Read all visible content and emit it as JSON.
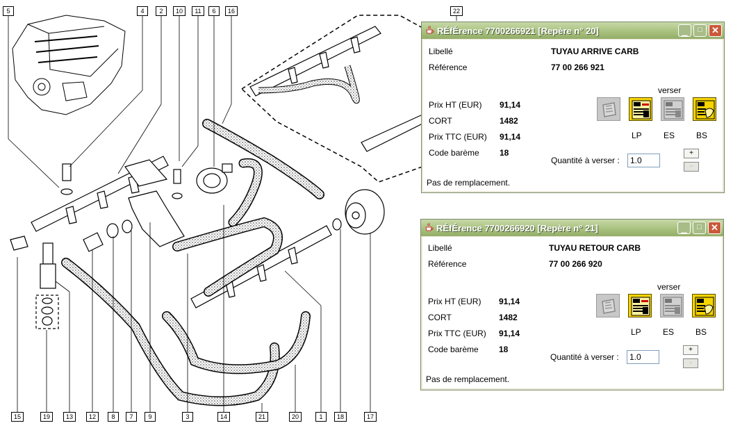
{
  "callouts": [
    {
      "id": "c5",
      "label": "5"
    },
    {
      "id": "c4",
      "label": "4"
    },
    {
      "id": "c2",
      "label": "2"
    },
    {
      "id": "c10",
      "label": "10"
    },
    {
      "id": "c11",
      "label": "11"
    },
    {
      "id": "c6",
      "label": "6"
    },
    {
      "id": "c16",
      "label": "16"
    },
    {
      "id": "c22",
      "label": "22"
    },
    {
      "id": "c15",
      "label": "15"
    },
    {
      "id": "c19",
      "label": "19"
    },
    {
      "id": "c13",
      "label": "13"
    },
    {
      "id": "c12",
      "label": "12"
    },
    {
      "id": "c8",
      "label": "8"
    },
    {
      "id": "c7",
      "label": "7"
    },
    {
      "id": "c9",
      "label": "9"
    },
    {
      "id": "c3",
      "label": "3"
    },
    {
      "id": "c14",
      "label": "14"
    },
    {
      "id": "c21",
      "label": "21"
    },
    {
      "id": "c20",
      "label": "20"
    },
    {
      "id": "c1",
      "label": "1"
    },
    {
      "id": "c18",
      "label": "18"
    },
    {
      "id": "c17",
      "label": "17"
    }
  ],
  "windows": [
    {
      "title": "RÉfÉrence 7700266921 [Repère n° 20]",
      "libelle_label": "Libellé",
      "libelle_value": "TUYAU ARRIVE CARB",
      "reference_label": "Référence",
      "reference_value": "77 00 266 921",
      "prix_ht_label": "Prix HT (EUR)",
      "prix_ht_value": "91,14",
      "cort_label": "CORT",
      "cort_value": "1482",
      "prix_ttc_label": "Prix TTC (EUR)",
      "prix_ttc_value": "91,14",
      "code_label": "Code barème",
      "code_value": "18",
      "verser_label": "verser",
      "btn_lp": "LP",
      "btn_es": "ES",
      "btn_bs": "BS",
      "quantity_label": "Quantité à verser :",
      "quantity_value": "1.0",
      "plus": "+",
      "minus": "-",
      "status": "Pas de remplacement."
    },
    {
      "title": "RÉfÉrence 7700266920 [Repère n° 21]",
      "libelle_label": "Libellé",
      "libelle_value": "TUYAU RETOUR CARB",
      "reference_label": "Référence",
      "reference_value": "77 00 266 920",
      "prix_ht_label": "Prix HT (EUR)",
      "prix_ht_value": "91,14",
      "cort_label": "CORT",
      "cort_value": "1482",
      "prix_ttc_label": "Prix TTC (EUR)",
      "prix_ttc_value": "91,14",
      "code_label": "Code barème",
      "code_value": "18",
      "verser_label": "verser",
      "btn_lp": "LP",
      "btn_es": "ES",
      "btn_bs": "BS",
      "quantity_label": "Quantité à verser :",
      "quantity_value": "1.0",
      "plus": "+",
      "minus": "-",
      "status": "Pas de remplacement."
    }
  ],
  "icons": {
    "app": "java-cup-icon",
    "disabled_button": "part-box-icon",
    "lp": "lp-catalog-icon",
    "es": "es-catalog-icon",
    "bs": "bs-catalog-icon"
  }
}
